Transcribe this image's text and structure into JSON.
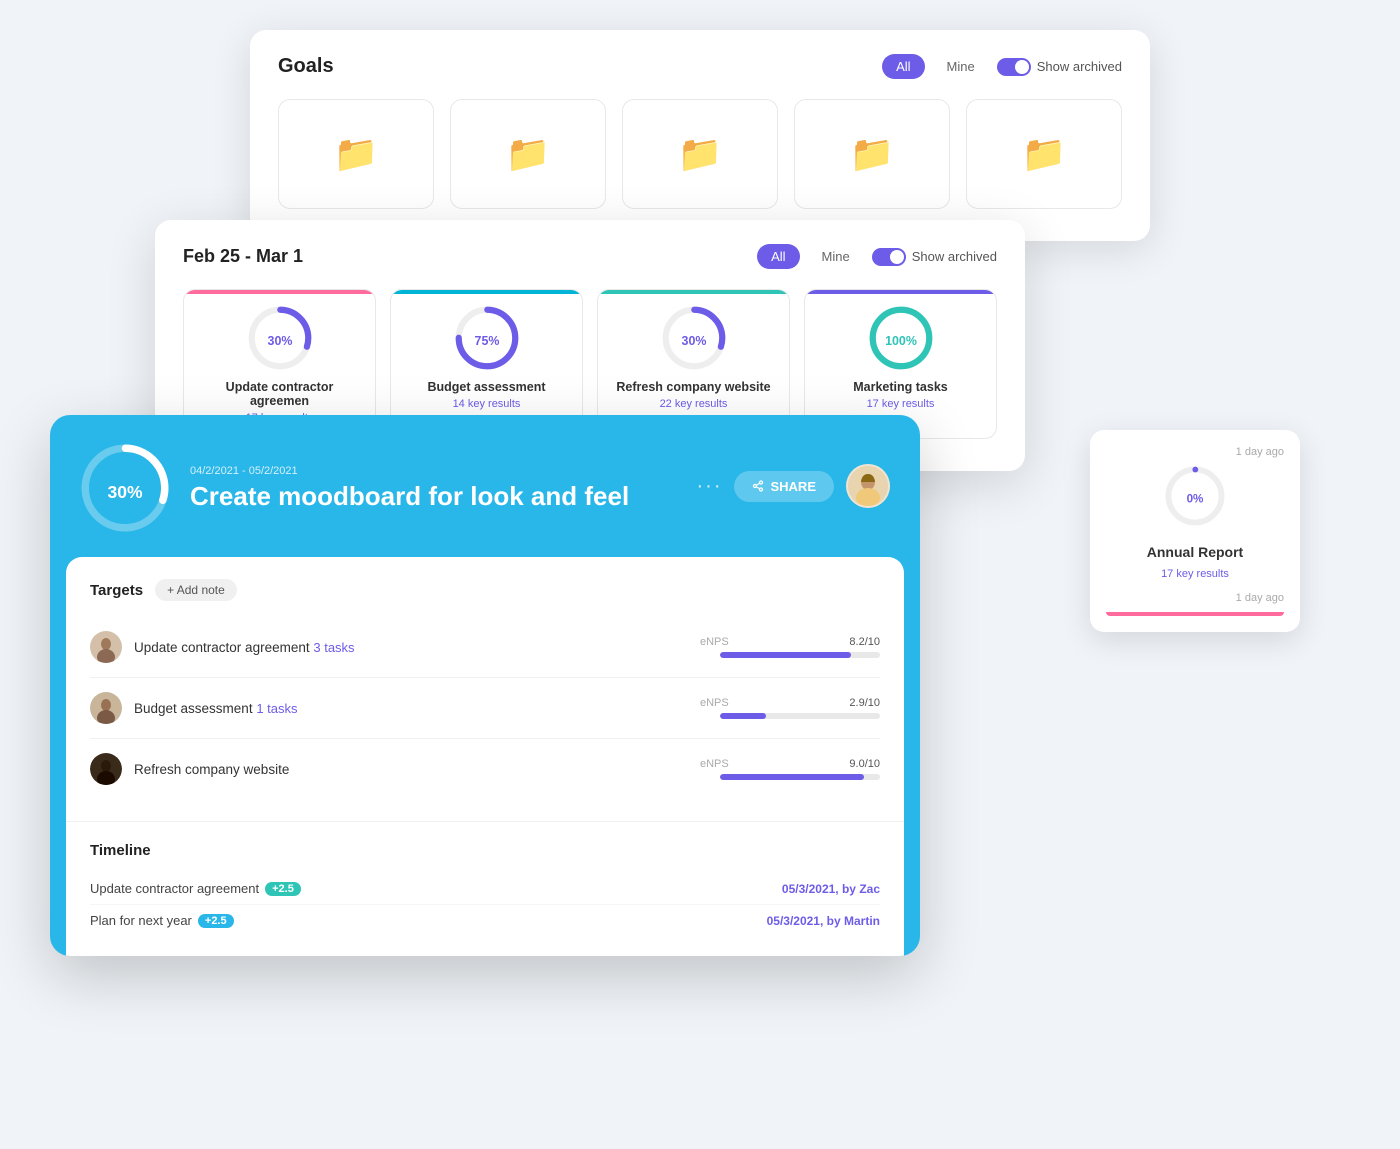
{
  "goals_card": {
    "title": "Goals",
    "filter": {
      "all_label": "All",
      "mine_label": "Mine",
      "show_archived_label": "Show archived"
    },
    "folders": [
      {
        "id": 1
      },
      {
        "id": 2
      },
      {
        "id": 3
      },
      {
        "id": 4
      },
      {
        "id": 5
      }
    ]
  },
  "weekly_card": {
    "title": "Feb 25 - Mar 1",
    "filter": {
      "all_label": "All",
      "mine_label": "Mine",
      "show_archived_label": "Show archived"
    },
    "goals": [
      {
        "name": "Update contractor agreemen",
        "key_results": "17 key results",
        "percent": 30,
        "color": "pink",
        "donut_color": "#6c5ce7"
      },
      {
        "name": "Budget assessment",
        "key_results": "14 key results",
        "percent": 75,
        "color": "blue",
        "donut_color": "#6c5ce7"
      },
      {
        "name": "Refresh company website",
        "key_results": "22 key results",
        "percent": 30,
        "color": "green",
        "donut_color": "#6c5ce7"
      },
      {
        "name": "Marketing tasks",
        "key_results": "17 key results",
        "percent": 100,
        "color": "purple",
        "donut_color": "#2ec4b6"
      }
    ]
  },
  "annual_card": {
    "time_ago": "1 day ago",
    "percent": "0%",
    "name": "Annual Report",
    "key_results": "17 key results",
    "time_ago2": "1 day ago"
  },
  "main_card": {
    "dates": "04/2/2021 - 05/2/2021",
    "title": "Create moodboard for look and feel",
    "percent": "30%",
    "share_label": "SHARE",
    "targets_title": "Targets",
    "add_note_label": "+ Add note",
    "targets": [
      {
        "name": "Update contractor agreement",
        "tasks": "3 tasks",
        "metric": "eNPS",
        "value": "8.2/10",
        "progress": 82
      },
      {
        "name": "Budget assessment",
        "tasks": "1 tasks",
        "metric": "eNPS",
        "value": "2.9/10",
        "progress": 29
      },
      {
        "name": "Refresh company website",
        "tasks": null,
        "metric": "eNPS",
        "value": "9.0/10",
        "progress": 90
      }
    ],
    "timeline_title": "Timeline",
    "timeline_rows": [
      {
        "name": "Update contractor agreement",
        "badge": "+2.5",
        "badge_type": "green",
        "date": "05/3/2021, by",
        "person": "Zac"
      },
      {
        "name": "Plan for next year",
        "badge": "+2.5",
        "badge_type": "blue",
        "date": "05/3/2021, by",
        "person": "Martin"
      }
    ]
  }
}
